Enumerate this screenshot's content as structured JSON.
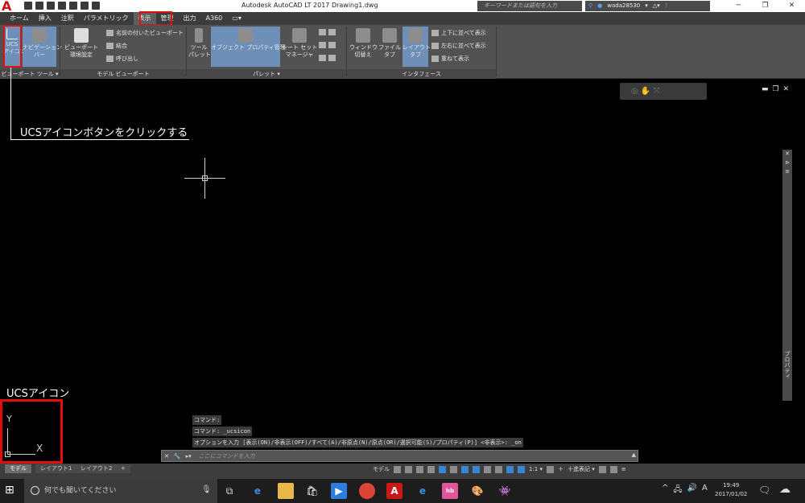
{
  "window": {
    "title": "Autodesk AutoCAD LT 2017   Drawing1.dwg",
    "search_placeholder": "キーワードまたは語句を入力",
    "user": "wada28530",
    "help": "?",
    "app_letter": "A"
  },
  "tabs": [
    "ホーム",
    "挿入",
    "注釈",
    "パラメトリック",
    "表示",
    "管理",
    "出力",
    "A360",
    "▭▾"
  ],
  "active_tab": "表示",
  "ribbon": {
    "ucs_icon": "UCS\nアイコン",
    "navigation_bar": "ナビゲーション\nバー",
    "viewport_config": "ビューポート\n環境設定",
    "named_viewports": "名前の付いたビューポート",
    "join": "結合",
    "restore": "呼び出し",
    "tool_palettes": "ツール\nパレット",
    "properties": "オブジェクト プロパティ管理",
    "sheet_set": "シート セット\nマネージャ",
    "switch_windows": "ウィンドウ\n切替え",
    "file_tabs": "ファイル\nタブ",
    "layout_tabs": "レイアウト\nタブ",
    "tile_horizontal": "上下に並べて表示",
    "tile_vertical": "左右に並べて表示",
    "cascade": "重ねて表示",
    "panel_viewport_tools": "ビューポート ツール ▾",
    "panel_model_viewports": "モデル ビューポート",
    "panel_palettes": "パレット ▾",
    "panel_interface": "インタフェース"
  },
  "annotations": {
    "callout": "UCSアイコンボタンをクリックする",
    "ucs_label": "UCSアイコン"
  },
  "ucs": {
    "y": "Y",
    "x": "X"
  },
  "command_history": [
    "コマンド:",
    "コマンド: _ucsicon",
    "オプションを入力 [表示(ON)/非表示(OFF)/すべて(A)/非原点(N)/原点(OR)/選択可能(S)/プロパティ(P)] <非表示>: _on"
  ],
  "command_placeholder": "ここにコマンドを入力",
  "layout_tabs": [
    "モデル",
    "レイアウト1",
    "レイアウト2",
    "+"
  ],
  "status": {
    "model": "モデル",
    "scale": "1:1 ▾",
    "decimal": "十進表記 ▾"
  },
  "right_palette": {
    "label": "プロパティ"
  },
  "taskbar": {
    "search": "何でも聞いてください",
    "time": "19:49",
    "date": "2017/01/02",
    "ime": "A"
  },
  "colors": {
    "highlight": "#e01010",
    "ribbon": "#525252",
    "canvas": "#000000",
    "accent": "#3a84d6"
  }
}
